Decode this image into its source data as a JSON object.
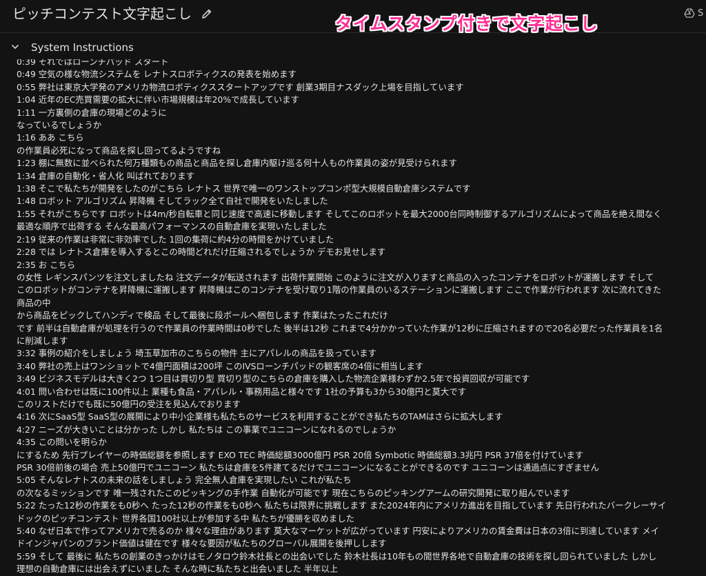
{
  "header": {
    "title": "ピッチコンテスト文字起こし",
    "edit_icon": "pencil-icon",
    "right_icon": "drive-icon",
    "right_label": "S"
  },
  "overlay": {
    "caption": "タイムスタンプ付きで文字起こし",
    "color": "#ff2d93"
  },
  "section": {
    "title": "System Instructions",
    "icon": "chevron-down-icon"
  },
  "transcript": {
    "lines": [
      "0:39 それではローンチパッド スタート",
      "0:49 空気の様な物流システムを レナトスロボティクスの発表を始めます",
      "0:55 弊社は東京大学発のアメリカ物流ロボティクススタートアップです 創業3期目ナスダック上場を目指しています",
      "1:04 近年のEC売買需要の拡大に伴い市場規模は年20%で成長しています",
      "1:11 一方裏側の倉庫の現場どのように",
      "なっているでしょうか",
      "1:16 ああ こちら",
      "の作業員必死になって商品を探し回ってるようですね",
      "1:23 棚に無数に並べられた何万種類もの商品と商品を探し倉庫内駆け巡る何十人もの作業員の姿が見受けられます",
      "1:34 倉庫の自動化・省人化 叫ばれております",
      "1:38 そこで私たちが開発をしたのがこちら レナトス 世界で唯一のワンストップコンポ型大規模自動倉庫システムです",
      "1:48 ロボット アルゴリズム 昇降機 そしてラック全て自社で開発をいたしました",
      "1:55 それがこちらです ロボットは4m/秒自転車と同じ速度で高速に移動します そしてこのロボットを最大2000台同時制御するアルゴリズムによって商品を絶え間なく",
      "最適な順序で出荷する そんな最高パフォーマンスの自動倉庫を実現いたしました",
      "2:19 従来の作業は非常に非効率でした 1回の集荷に約4分の時間をかけていました",
      "2:28 では レナトス倉庫を導入するとこの時間どれだけ圧縮されるでしょうか デモお見せします",
      "2:35 お こちら",
      "の女性 レギンスパンツを注文しましたね 注文データが転送されます 出荷作業開始 このように注文が入りますと商品の入ったコンテナをロボットが運搬します そして",
      "このロボットがコンテナを昇降機に運搬します 昇降機はこのコンテナを受け取り1階の作業員のいるステーションに運搬します ここで作業が行われます 次に流れてきた",
      "商品の中",
      "から商品をピックしてハンディで検品 そして最後に段ボールへ梱包します 作業はたったこれだけ",
      "です 前半は自動倉庫が処理を行うので作業員の作業時間は0秒でした 後半は12秒 これまで4分かかっていた作業が12秒に圧縮されますので20名必要だった作業員を1名",
      "に削減します",
      "3:32 事例の紹介をしましょう 埼玉草加市のこちらの物件 主にアパレルの商品を扱っています",
      "3:40 弊社の売上はワンショットで4億円面積は200坪 このIVSローンチパッドの観客席の4倍に相当します",
      "3:49 ビジネスモデルは大きく2つ 1つ目は買切り型 買切り型のこちらの倉庫を購入した物流企業様わずか2.5年で投資回収が可能です",
      "4:01 問い合わせは既に100件以上 業種も食品・アパレル・事務用品と様々です 1社の予算も3から30億円と莫大です",
      "このリストだけでも既に50億円の受注を見込んでおります",
      "4:16 次にSaaS型 SaaS型の展開により中小企業様も私たちのサービスを利用することができ私たちのTAMはさらに拡大します",
      "4:27 ニーズが大きいことは分かった しかし 私たちは この事業でユニコーンになれるのでしょうか",
      "4:35 この問いを明らか",
      "にするため 先行プレイヤーの時価総額を参照します EXO TEC 時価総額3000億円 PSR 20倍 Symbotic 時価総額3.3兆円 PSR 37倍を付けています",
      "PSR 30倍前後の場合 売上50億円でユニコーン 私たちは倉庫を5件建てるだけでユニコーンになることができるのです ユニコーンは通過点にすぎません",
      "5:05 そんなレナトスの未来の話をしましょう 完全無人倉庫を実現したい これが私たち",
      "の次なるミッションです 唯一残されたこのピッキングの手作業 自動化が可能です 現在こちらのピッキングアームの研究開発に取り組んでいます",
      "5:22 たった12秒の作業をも0秒へ たった12秒の作業をも0秒へ 私たちは限界に挑戦します また2024年内にアメリカ進出を目指しています 先日行われたバークレーサイ",
      "ドックのピッチコンテスト 世界各国100社以上が参加する中 私たちが優勝を収めました",
      "5:40 なぜ日本で作ってアメリカで売るのか 様々な理由があります 莫大なマーケットが広がっています 円安によりアメリカの賃金費は日本の3倍に到達しています メイ",
      "ドインジャパンのブランド価値は健在です 様々な要因が私たちのグローバル展開を後押しします",
      "5:59 そして 最後に 私たちの創業のきっかけはモノタロウ鈴木社長との出会いでした 鈴木社長は10年もの間世界各地で自動倉庫の技術を探し回られていました しかし",
      "理想の自動倉庫には出会えずにいました そんな時に私たちと出会いました 半年以上"
    ]
  }
}
